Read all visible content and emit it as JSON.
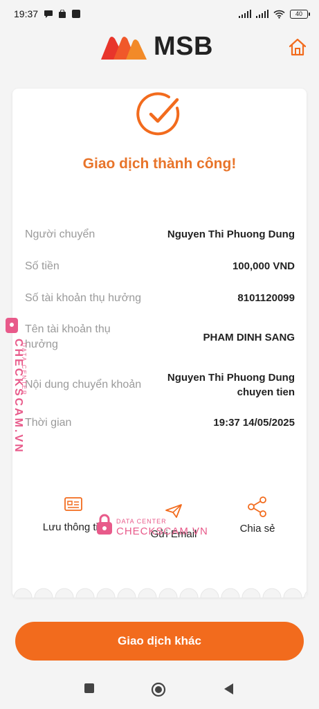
{
  "status_bar": {
    "time": "19:37",
    "battery": "40"
  },
  "header": {
    "logo_text": "MSB",
    "brand_colors": [
      "#e8352b",
      "#f28a28"
    ]
  },
  "receipt": {
    "title": "Giao dịch thành công!",
    "rows": [
      {
        "label": "Người chuyển",
        "value": "Nguyen Thi Phuong Dung"
      },
      {
        "label": "Số tiền",
        "value": "100,000 VND"
      },
      {
        "label": "Số tài khoản thụ hưởng",
        "value": "8101120099"
      },
      {
        "label": "Tên tài khoản thụ hưởng",
        "value": "PHAM DINH SANG"
      },
      {
        "label": "Nội dung chuyển khoản",
        "value": "Nguyen Thi Phuong Dung chuyen tien"
      },
      {
        "label": "Thời gian",
        "value": "19:37 14/05/2025"
      }
    ],
    "actions": [
      {
        "label": "Lưu thông tin",
        "icon": "save-card-icon"
      },
      {
        "label": "Gửi Email",
        "icon": "send-icon"
      },
      {
        "label": "Chia sẻ",
        "icon": "share-icon"
      }
    ]
  },
  "watermark": {
    "small": "DATA CENTER",
    "big": "CHECKSCAM.VN"
  },
  "primary_button": "Giao dịch khác",
  "colors": {
    "accent": "#f26b1d",
    "title": "#e8742a",
    "label": "#9a9a9a",
    "watermark": "#e85a8a"
  }
}
